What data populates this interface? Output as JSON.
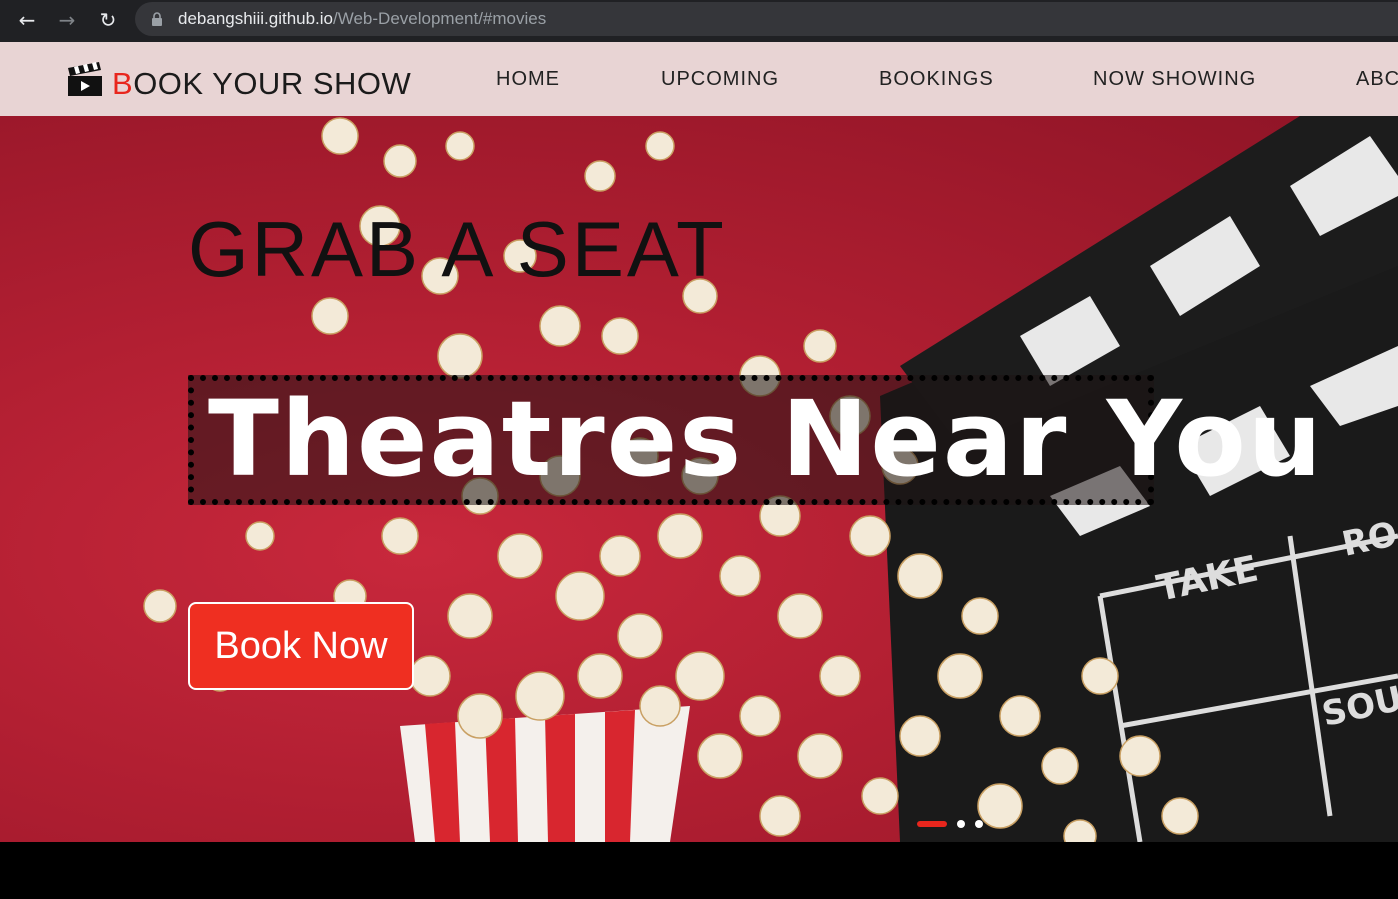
{
  "browser": {
    "url_host": "debangshiii.github.io",
    "url_path": "/Web-Development/#movies"
  },
  "navbar": {
    "brand_first": "B",
    "brand_rest": "OOK YOUR SHOW",
    "links": [
      "HOME",
      "UPCOMING",
      "BOOKINGS",
      "NOW SHOWING",
      "ABC"
    ]
  },
  "hero": {
    "tagline": "GRAB A SEAT",
    "headline": "Theatres Near You",
    "cta": "Book Now",
    "slides_total": 3,
    "active_slide": 1
  },
  "colors": {
    "accent": "#e8261d",
    "navbar_bg": "#e8d4d4",
    "hero_bg": "#b21f32"
  }
}
